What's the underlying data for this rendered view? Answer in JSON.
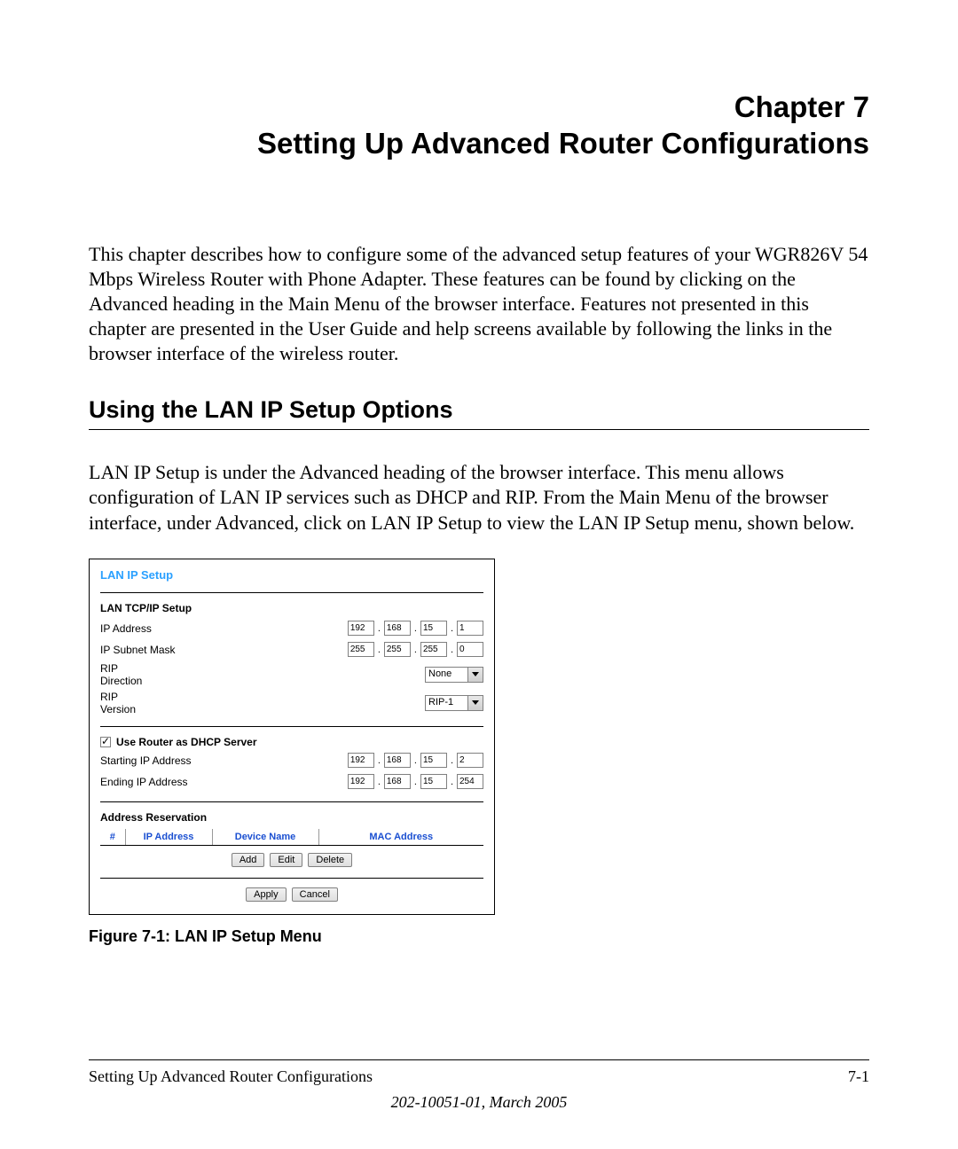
{
  "chapter": {
    "line1": "Chapter 7",
    "line2": "Setting Up Advanced Router Configurations"
  },
  "intro": "This chapter describes how to configure some of the advanced setup features of your WGR826V 54 Mbps Wireless Router with Phone Adapter. These features can be found by clicking on the Advanced heading in the Main Menu of the browser interface. Features not presented in this chapter are presented in the User Guide and help screens available by following the links in the browser interface of the wireless router.",
  "section_heading": "Using the LAN IP Setup Options",
  "section_para": "LAN IP Setup is under the Advanced heading of the browser interface. This menu allows configuration of LAN IP services such as DHCP and RIP. From the Main Menu of the browser interface, under Advanced, click on LAN IP Setup to view the LAN IP Setup menu, shown below.",
  "screenshot": {
    "title": "LAN IP Setup",
    "tcpip_heading": "LAN TCP/IP Setup",
    "labels": {
      "ip_address": "IP Address",
      "subnet_mask": "IP Subnet Mask",
      "rip_direction": "RIP Direction",
      "rip_version": "RIP Version",
      "dhcp_checkbox": "Use Router as DHCP Server",
      "starting_ip": "Starting IP Address",
      "ending_ip": "Ending IP Address",
      "reservation_heading": "Address Reservation"
    },
    "ip_address": [
      "192",
      "168",
      "15",
      "1"
    ],
    "subnet_mask": [
      "255",
      "255",
      "255",
      "0"
    ],
    "rip_direction_value": "None",
    "rip_version_value": "RIP-1",
    "starting_ip": [
      "192",
      "168",
      "15",
      "2"
    ],
    "ending_ip": [
      "192",
      "168",
      "15",
      "254"
    ],
    "res_headers": {
      "idx": "#",
      "ip": "IP Address",
      "dev": "Device Name",
      "mac": "MAC Address"
    },
    "buttons": {
      "add": "Add",
      "edit": "Edit",
      "delete": "Delete",
      "apply": "Apply",
      "cancel": "Cancel"
    }
  },
  "figure_caption": "Figure 7-1:  LAN IP Setup Menu",
  "footer": {
    "left": "Setting Up Advanced Router Configurations",
    "right": "7-1",
    "docmeta": "202-10051-01, March 2005"
  }
}
